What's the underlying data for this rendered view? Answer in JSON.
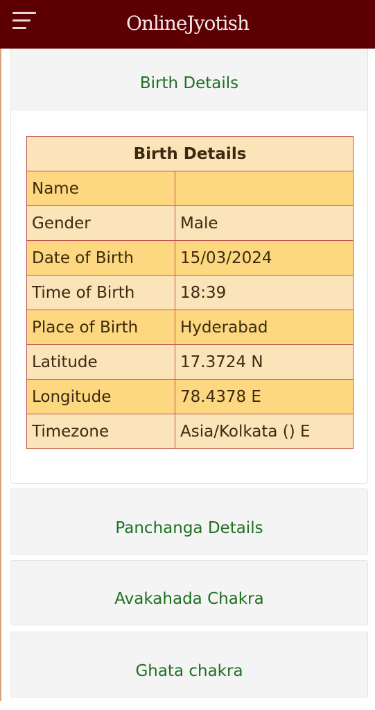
{
  "header": {
    "brand": "OnlineJyotish",
    "menu_icon": "hamburger-menu-icon",
    "background": "#5c0003"
  },
  "sections": {
    "birth_details": "Birth Details",
    "panchanga_details": "Panchanga Details",
    "avakahada_chakra": "Avakahada Chakra",
    "ghata_chakra": "Ghata chakra"
  },
  "table": {
    "title": "Birth Details",
    "rows": [
      {
        "label": "Name",
        "value": ""
      },
      {
        "label": "Gender",
        "value": "Male"
      },
      {
        "label": "Date of Birth",
        "value": "15/03/2024"
      },
      {
        "label": "Time of Birth",
        "value": "18:39"
      },
      {
        "label": "Place of Birth",
        "value": "Hyderabad"
      },
      {
        "label": "Latitude",
        "value": "17.3724 N"
      },
      {
        "label": "Longitude",
        "value": "78.4378 E"
      },
      {
        "label": "Timezone",
        "value": "Asia/Kolkata () E"
      }
    ]
  },
  "colors": {
    "accent_text": "#1f6e22",
    "row_dark": "#fdd880",
    "row_light": "#fbe4b9",
    "table_border": "#c2544e"
  }
}
